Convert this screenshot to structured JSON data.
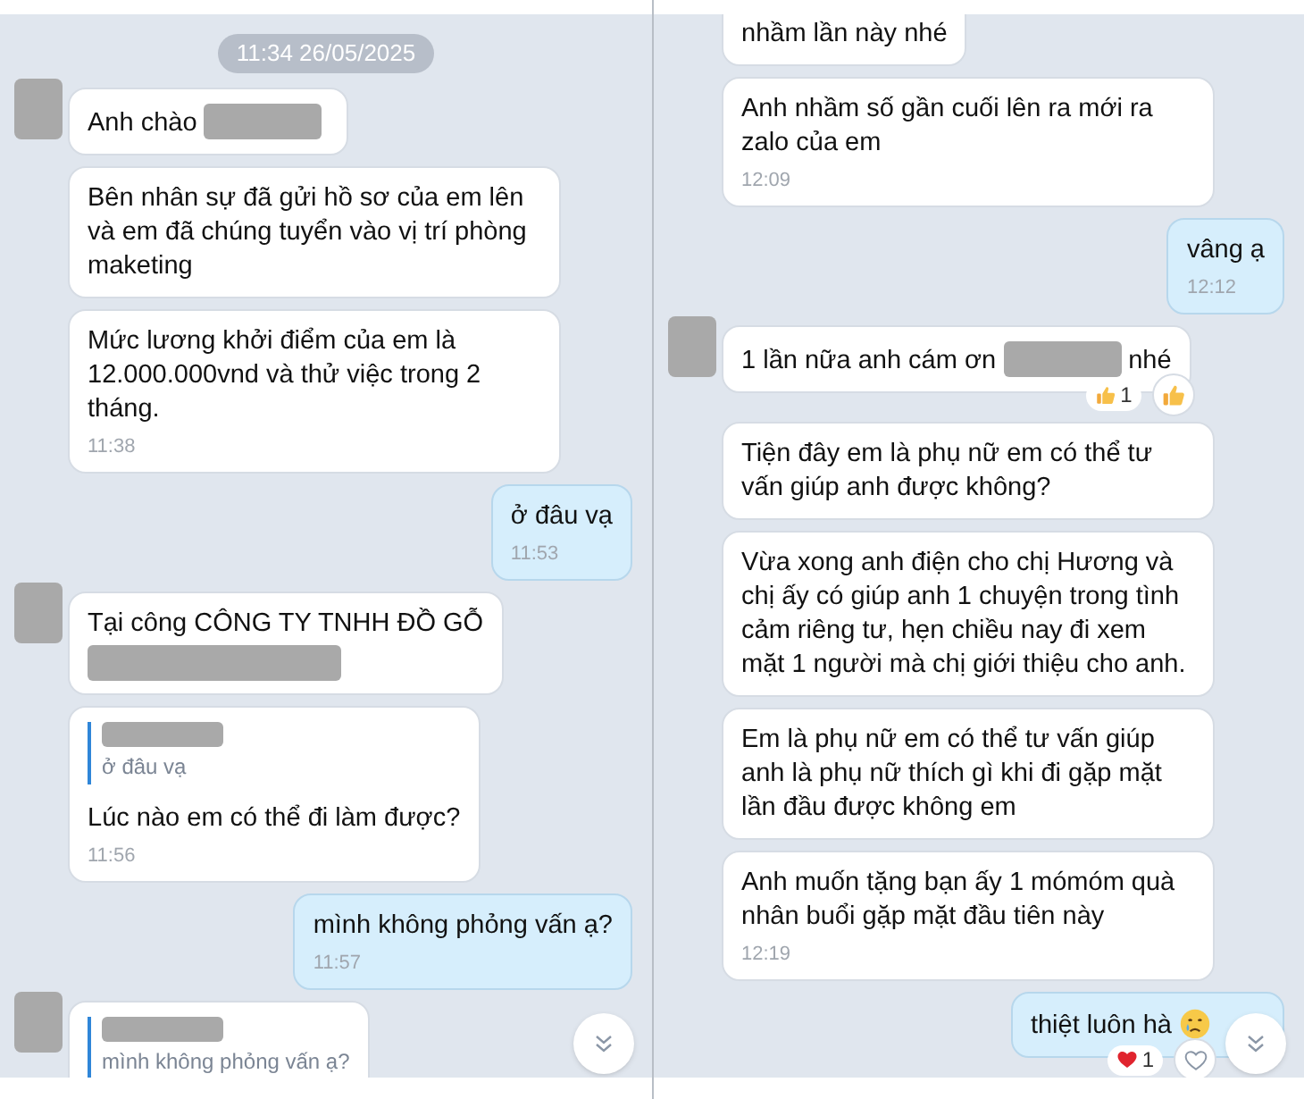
{
  "panels": [
    {
      "messages": [
        {
          "kind": "date",
          "text": "11:34 26/05/2025"
        },
        {
          "kind": "received",
          "avatar": true,
          "parts": [
            {
              "kind": "text",
              "text": "Anh chào"
            },
            {
              "kind": "redacted"
            }
          ]
        },
        {
          "kind": "received",
          "avatar": false,
          "parts": [
            {
              "kind": "text",
              "text": "Bên nhân sự đã gửi hồ sơ của em lên và em đã chúng tuyển vào vị trí phòng maketing"
            }
          ]
        },
        {
          "kind": "received",
          "avatar": false,
          "parts": [
            {
              "kind": "text",
              "text": "Mức lương khởi điểm của em là 12.000.000vnd và thử việc trong 2 tháng."
            }
          ],
          "time": "11:38"
        },
        {
          "kind": "sent",
          "parts": [
            {
              "kind": "text",
              "text": "ở đâu vạ"
            }
          ],
          "time": "11:53"
        },
        {
          "kind": "received",
          "avatar": true,
          "parts": [
            {
              "kind": "text",
              "text": "Tại công  CÔNG TY TNHH ĐỒ GỖ"
            },
            {
              "kind": "redacted_line"
            }
          ]
        },
        {
          "kind": "received",
          "avatar": false,
          "quote": {
            "text": "ở đâu vạ"
          },
          "parts": [
            {
              "kind": "text",
              "text": "Lúc nào em có thể đi làm được?"
            }
          ],
          "time": "11:56"
        },
        {
          "kind": "sent",
          "parts": [
            {
              "kind": "text",
              "text": "mình không phỏng vấn ạ?"
            }
          ],
          "time": "11:57"
        },
        {
          "kind": "received",
          "avatar": true,
          "quote": {
            "text": "mình không phỏng vấn ạ?"
          }
        }
      ]
    },
    {
      "messages": [
        {
          "kind": "received",
          "avatar": false,
          "cut_top": true,
          "parts": [
            {
              "kind": "text",
              "text": "nhầm lần này nhé"
            }
          ]
        },
        {
          "kind": "received",
          "avatar": false,
          "parts": [
            {
              "kind": "text",
              "text": "Anh nhầm số gần cuối lên ra mới ra zalo của em"
            }
          ],
          "time": "12:09"
        },
        {
          "kind": "sent",
          "parts": [
            {
              "kind": "text",
              "text": "vâng ạ"
            }
          ],
          "time": "12:12"
        },
        {
          "kind": "received",
          "avatar": true,
          "parts": [
            {
              "kind": "text",
              "text": "1 lần nữa anh cám ơn"
            },
            {
              "kind": "redacted"
            },
            {
              "kind": "text",
              "text": "nhé"
            }
          ],
          "reaction": {
            "kind": "like",
            "count": "1"
          }
        },
        {
          "kind": "received",
          "avatar": false,
          "parts": [
            {
              "kind": "text",
              "text": "Tiện đây em là phụ nữ em có thể tư vấn giúp anh được không?"
            }
          ]
        },
        {
          "kind": "received",
          "avatar": false,
          "parts": [
            {
              "kind": "text",
              "text": "Vừa xong anh điện cho chị Hương và chị ấy có giúp anh 1 chuyện trong tình cảm riêng tư, hẹn chiều nay đi xem mặt 1 người mà chị giới thiệu cho anh."
            }
          ]
        },
        {
          "kind": "received",
          "avatar": false,
          "parts": [
            {
              "kind": "text",
              "text": "Em là phụ nữ em có thể tư vấn giúp anh là phụ nữ thích gì khi đi gặp mặt lần đầu được không em"
            }
          ]
        },
        {
          "kind": "received",
          "avatar": false,
          "parts": [
            {
              "kind": "text",
              "text": "Anh muốn tặng bạn ấy 1 mómóm quà nhân buổi gặp mặt đầu tiên này"
            }
          ],
          "time": "12:19"
        },
        {
          "kind": "sent",
          "parts": [
            {
              "kind": "text",
              "text": "thiệt luôn hà"
            },
            {
              "kind": "crying_emoji"
            }
          ],
          "reaction": {
            "kind": "heart",
            "count": "1"
          }
        }
      ]
    }
  ]
}
